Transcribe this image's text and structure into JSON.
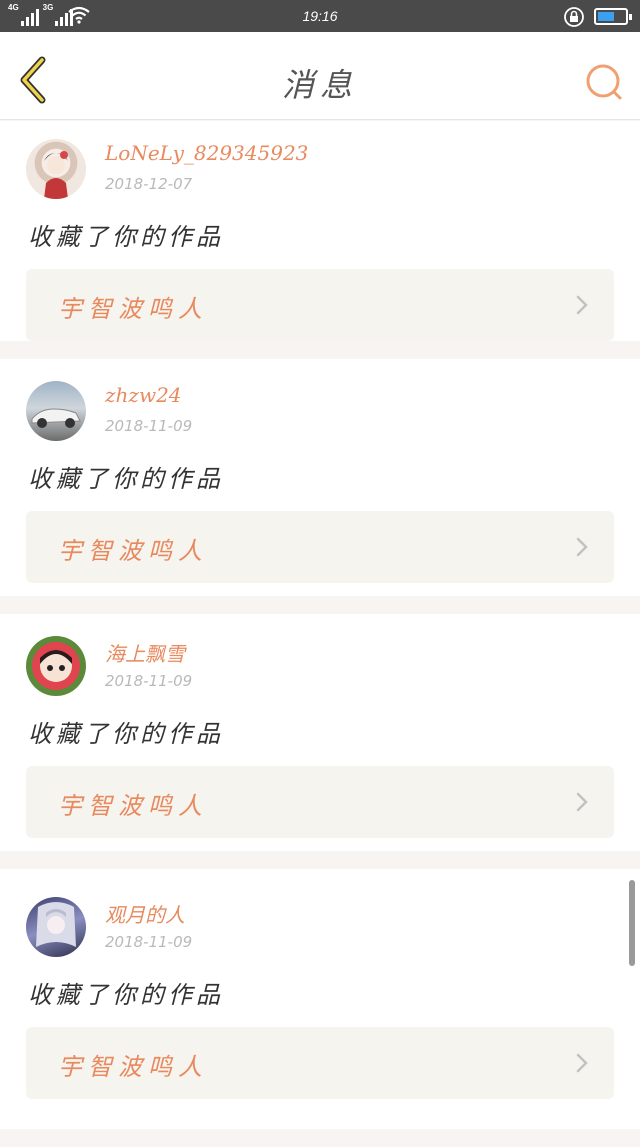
{
  "status_bar": {
    "time": "19:16",
    "network_labels": [
      "4G",
      "3G"
    ],
    "battery_color": "#3aa0f2"
  },
  "header": {
    "title": "消息",
    "back_icon": "chevron-left-icon",
    "search_icon": "search-icon",
    "accent_color": "#e8895e"
  },
  "messages": [
    {
      "user": "LoNeLy_829345923",
      "date": "2018-12-07",
      "action": "收藏了你的作品",
      "work_title": "宇智波鸣人"
    },
    {
      "user": "zhzw24",
      "date": "2018-11-09",
      "action": "收藏了你的作品",
      "work_title": "宇智波鸣人"
    },
    {
      "user": "海上飘雪",
      "date": "2018-11-09",
      "action": "收藏了你的作品",
      "work_title": "宇智波鸣人"
    },
    {
      "user": "观月的人",
      "date": "2018-11-09",
      "action": "收藏了你的作品",
      "work_title": "宇智波鸣人"
    }
  ]
}
